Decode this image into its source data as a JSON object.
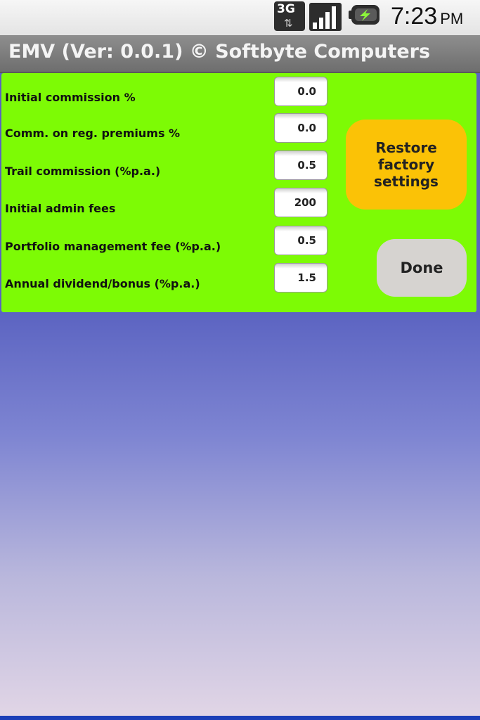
{
  "status_bar": {
    "network_type": "3G",
    "network_arrows": "⇅",
    "time": "7:23",
    "ampm": "PM",
    "icons": [
      "network-3g-icon",
      "signal-strength-icon",
      "battery-charging-icon"
    ]
  },
  "app": {
    "title": "EMV (Ver: 0.0.1) © Softbyte Computers"
  },
  "settings": {
    "rows": [
      {
        "label": "Initial commission %",
        "value": "0.0"
      },
      {
        "label": "Comm. on reg. premiums %",
        "value": "0.0"
      },
      {
        "label": "Trail commission (%p.a.)",
        "value": "0.5"
      },
      {
        "label": "Initial admin fees",
        "value": "200"
      },
      {
        "label": "Portfolio management fee (%p.a.)",
        "value": "0.5"
      },
      {
        "label": "Annual dividend/bonus (%p.a.)",
        "value": "1.5"
      }
    ],
    "restore_label": "Restore factory settings",
    "done_label": "Done"
  },
  "colors": {
    "panel_bg": "#7dfb05",
    "restore_button": "#fbc206",
    "done_button": "#d6d3d0",
    "title_bar": "#7e7e7e"
  }
}
